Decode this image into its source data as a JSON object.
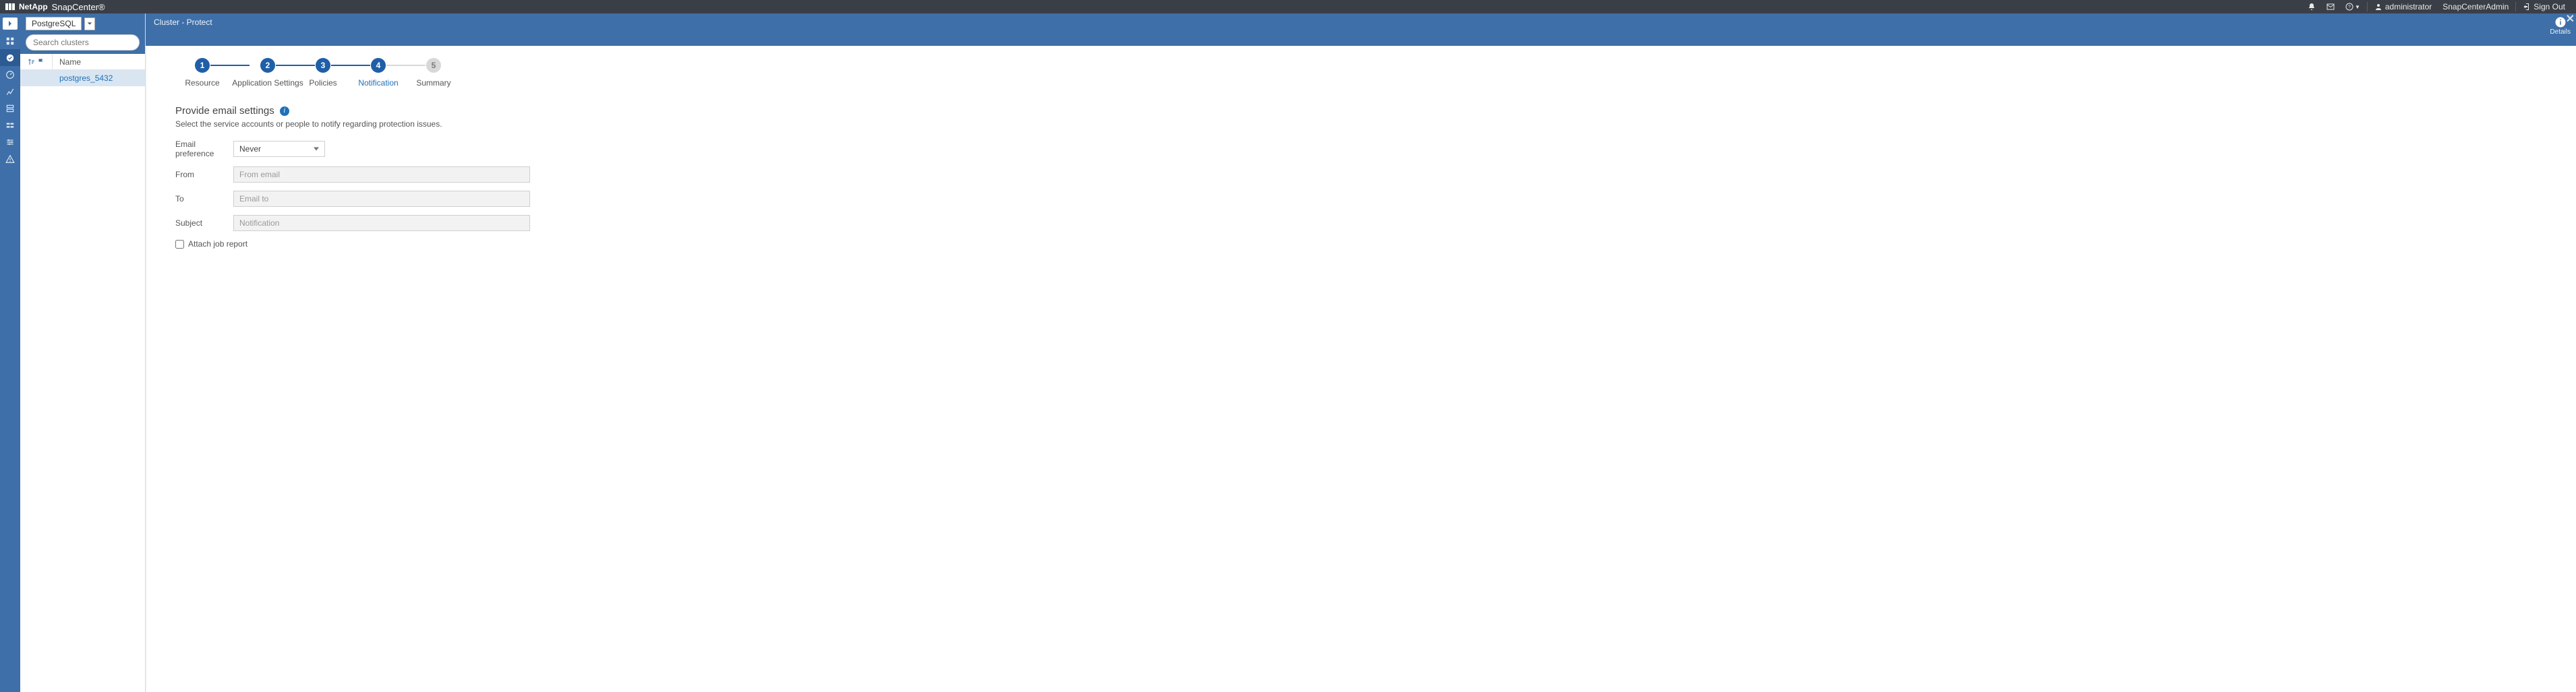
{
  "header": {
    "brand_company": "NetApp",
    "brand_product": "SnapCenter®",
    "user": "administrator",
    "role": "SnapCenterAdmin",
    "signout": "Sign Out"
  },
  "rail": {
    "items": [
      {
        "name": "expand-icon"
      },
      {
        "name": "dashboard-icon"
      },
      {
        "name": "resources-icon",
        "active": true
      },
      {
        "name": "monitor-icon"
      },
      {
        "name": "reports-icon"
      },
      {
        "name": "hosts-icon"
      },
      {
        "name": "storage-icon"
      },
      {
        "name": "settings-icon"
      },
      {
        "name": "alerts-icon"
      }
    ]
  },
  "left_panel": {
    "plugin": "PostgreSQL",
    "search_placeholder": "Search clusters",
    "col_name": "Name",
    "rows": [
      {
        "name": "postgres_5432"
      }
    ]
  },
  "main": {
    "breadcrumb": "Cluster - Protect",
    "details_label": "Details"
  },
  "wizard": {
    "steps": [
      {
        "num": "1",
        "label": "Resource"
      },
      {
        "num": "2",
        "label": "Application Settings"
      },
      {
        "num": "3",
        "label": "Policies"
      },
      {
        "num": "4",
        "label": "Notification",
        "current": true
      },
      {
        "num": "5",
        "label": "Summary",
        "pending": true
      }
    ]
  },
  "form": {
    "title": "Provide email settings",
    "subtitle": "Select the service accounts or people to notify regarding protection issues.",
    "email_pref_label": "Email preference",
    "email_pref_value": "Never",
    "from_label": "From",
    "from_placeholder": "From email",
    "to_label": "To",
    "to_placeholder": "Email to",
    "subject_label": "Subject",
    "subject_placeholder": "Notification",
    "attach_label": "Attach job report"
  }
}
